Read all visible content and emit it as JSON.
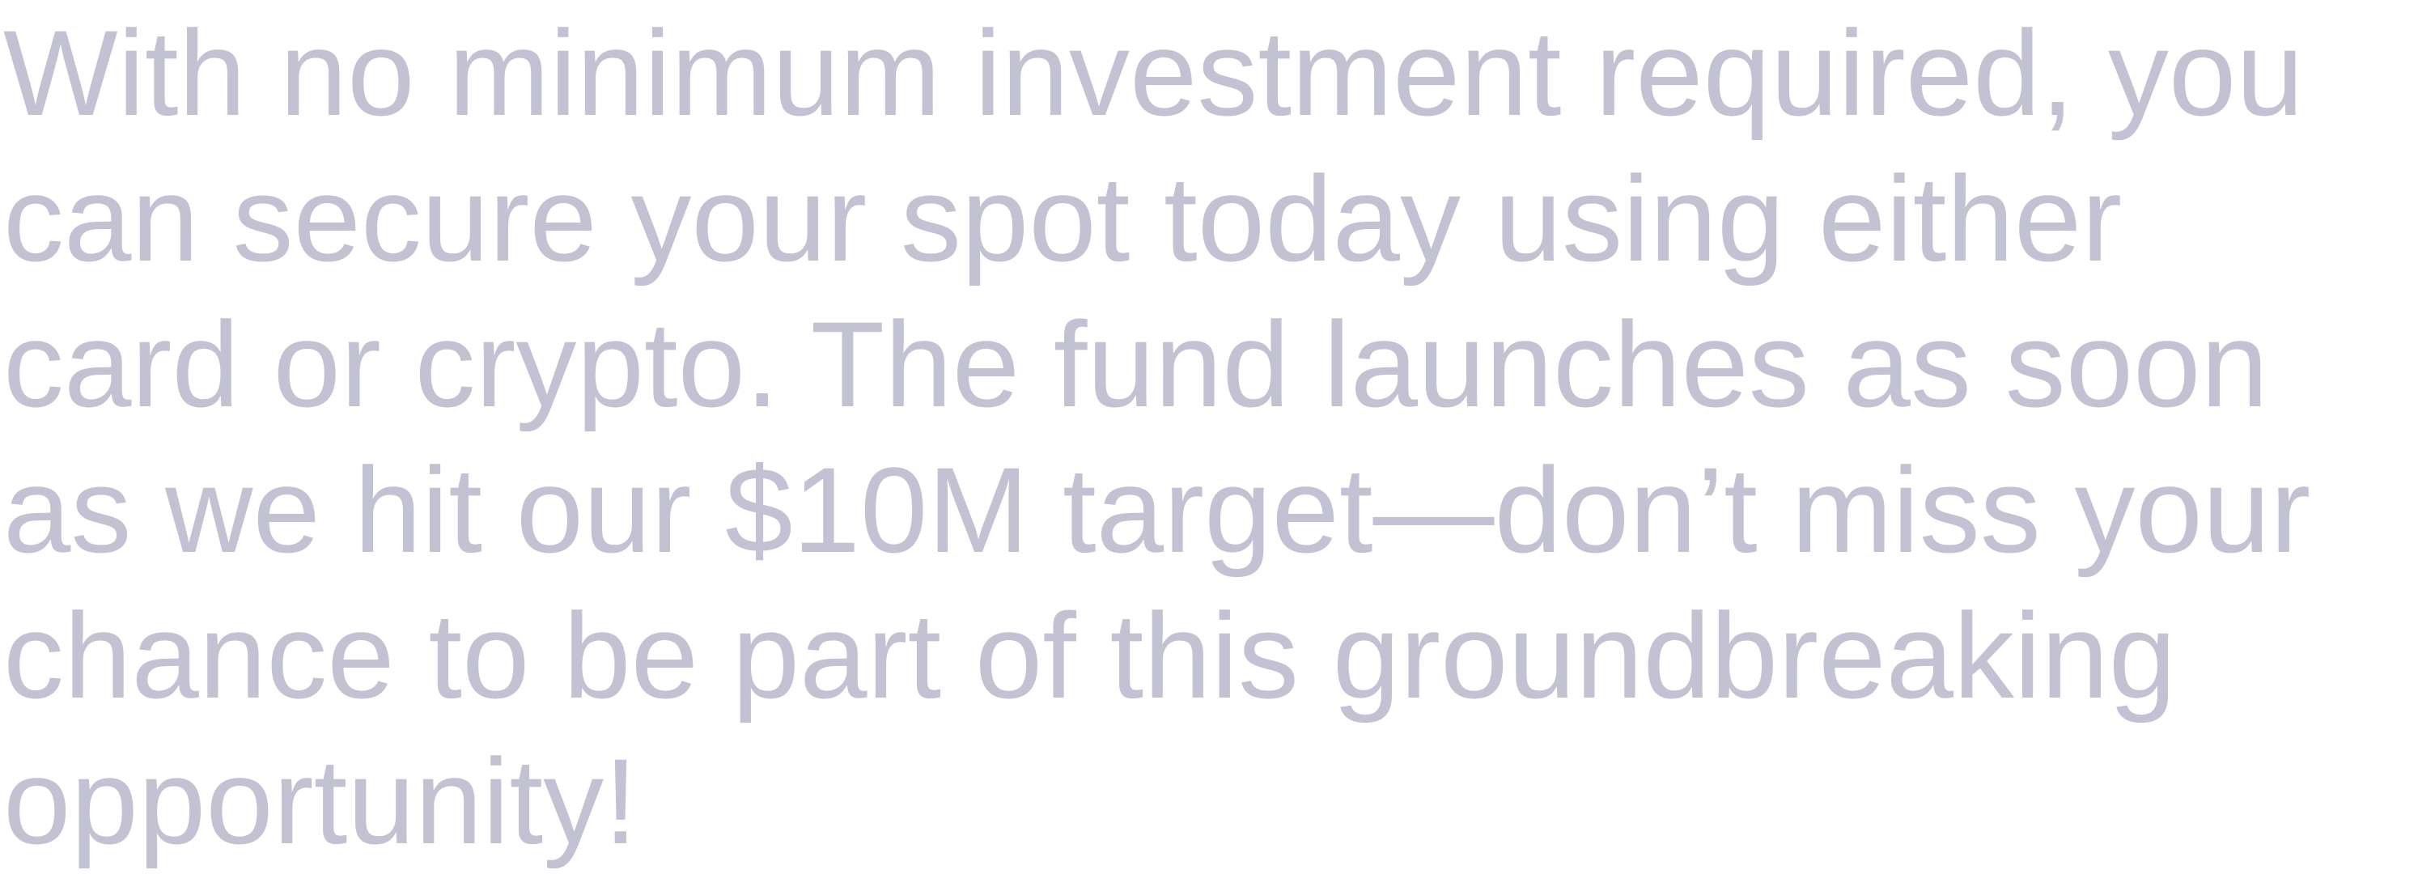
{
  "colors": {
    "text": "#c3c2d2",
    "background": "#ffffff"
  },
  "paragraph": {
    "lines": [
      "With no minimum investment required, you",
      "can secure your spot today using either",
      "card or crypto. The fund launches as soon",
      "as we hit our $10M target—don’t miss your",
      "chance to be part of this groundbreaking",
      "opportunity!"
    ]
  }
}
